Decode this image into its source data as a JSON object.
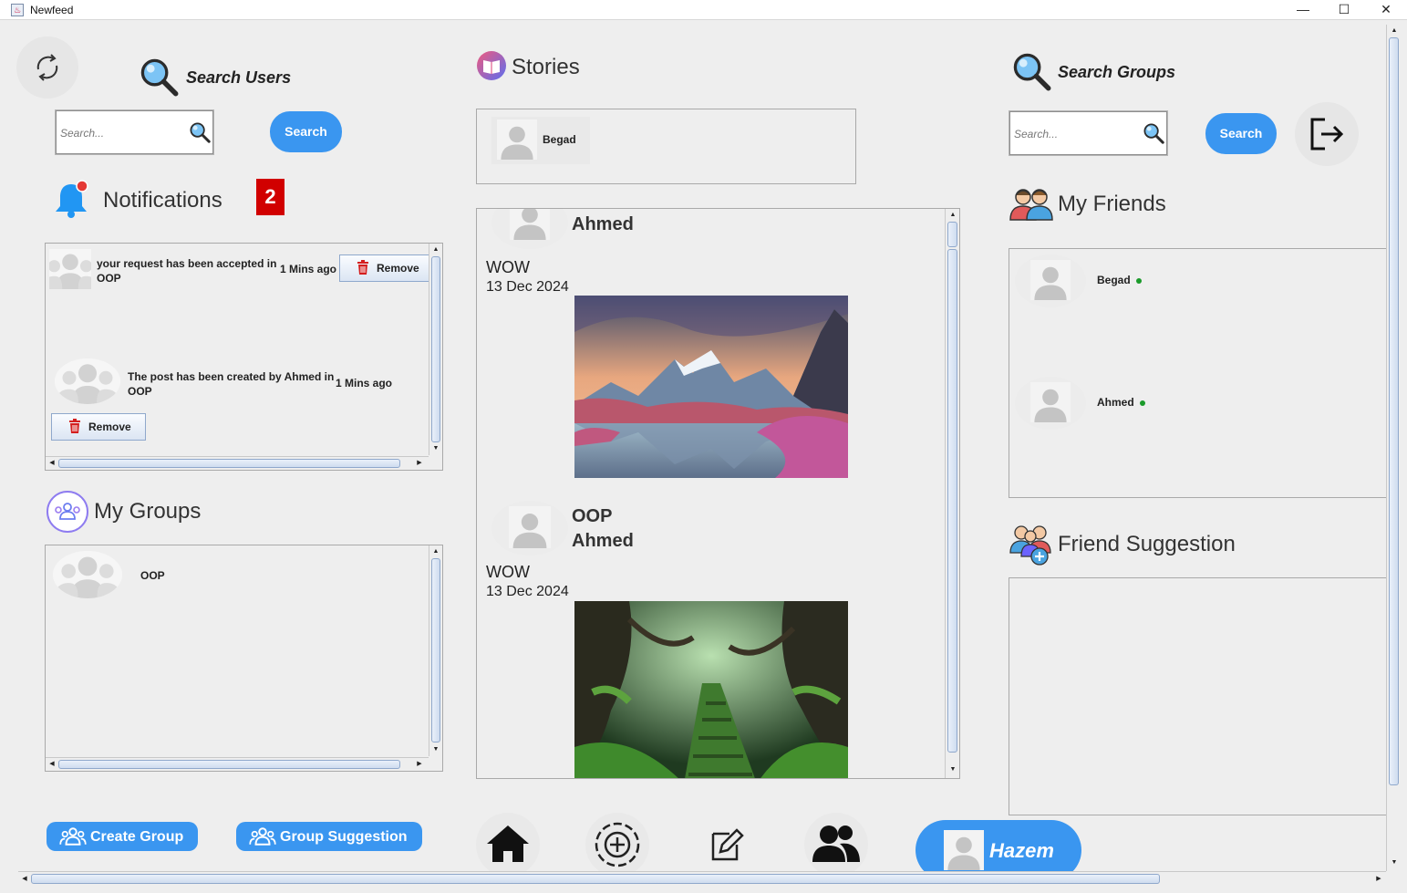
{
  "window": {
    "title": "Newfeed",
    "minimize": "—",
    "maximize": "☐",
    "close": "✕"
  },
  "left": {
    "refresh_icon": "refresh-icon",
    "search_users": {
      "title": "Search Users",
      "placeholder": "Search...",
      "button": "Search"
    },
    "notifications": {
      "title": "Notifications",
      "badge": "2",
      "items": [
        {
          "text": "your request has been accepted in OOP",
          "time": "1 Mins ago",
          "remove": "Remove"
        },
        {
          "text": "The post has been created by Ahmed in OOP",
          "time": "1 Mins ago",
          "remove": "Remove"
        }
      ]
    },
    "groups": {
      "title": "My Groups",
      "items": [
        {
          "name": "OOP"
        }
      ]
    },
    "buttons": {
      "create_group": "Create Group",
      "group_suggestion": "Group Suggestion"
    }
  },
  "center": {
    "stories": {
      "title": "Stories",
      "items": [
        {
          "name": "Begad"
        }
      ]
    },
    "posts": [
      {
        "author": "Ahmed",
        "text": "WOW",
        "date": "13 Dec 2024",
        "image": "mountain-lake-image"
      },
      {
        "group": "OOP",
        "author": "Ahmed",
        "text": "WOW",
        "date": "13 Dec 2024",
        "image": "forest-path-image"
      }
    ]
  },
  "right": {
    "search_groups": {
      "title": "Search Groups",
      "placeholder": "Search...",
      "button": "Search"
    },
    "friends": {
      "title": "My Friends",
      "items": [
        {
          "name": "Begad",
          "online": true
        },
        {
          "name": "Ahmed",
          "online": true
        }
      ]
    },
    "suggestions": {
      "title": "Friend Suggestion",
      "items": []
    }
  },
  "bottom_nav": {
    "icons": [
      "home-icon",
      "add-post-icon",
      "edit-icon",
      "friends-icon"
    ],
    "user": "Hazem"
  },
  "colors": {
    "accent": "#3a96f0",
    "badge": "#d10000",
    "online": "#1a9a2a"
  }
}
